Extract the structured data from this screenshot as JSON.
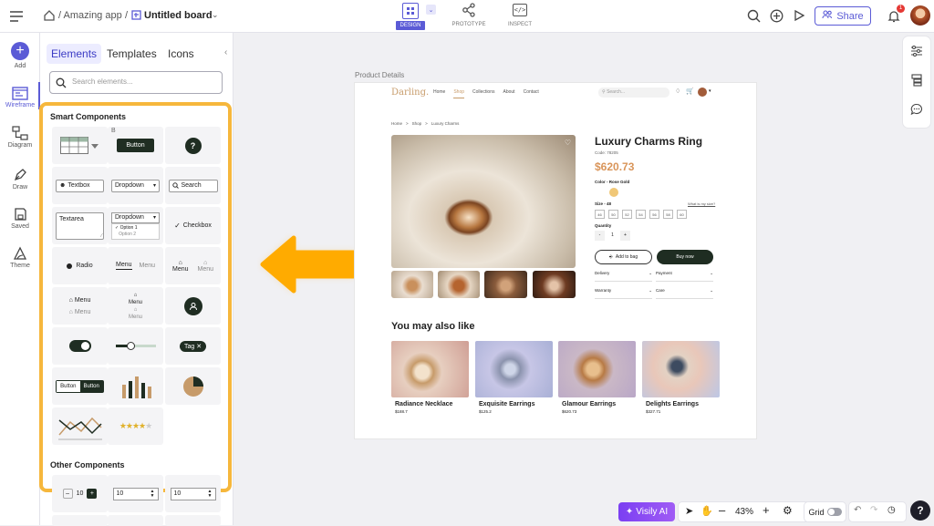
{
  "topbar": {
    "app_crumb": "/ Amazing app",
    "board_sep": "/",
    "board_name": "Untitled board",
    "modes": [
      {
        "label": "DESIGN",
        "active": true
      },
      {
        "label": "PROTOTYPE",
        "active": false
      },
      {
        "label": "INSPECT",
        "active": false
      }
    ],
    "share_label": "Share",
    "notification_count": "1"
  },
  "rail": {
    "items": [
      {
        "label": "Add",
        "icon": "plus-icon"
      },
      {
        "label": "Wireframe",
        "icon": "wireframe-icon"
      },
      {
        "label": "Diagram",
        "icon": "diagram-icon"
      },
      {
        "label": "Draw",
        "icon": "pen-icon"
      },
      {
        "label": "Saved",
        "icon": "save-icon"
      },
      {
        "label": "Theme",
        "icon": "theme-icon"
      }
    ]
  },
  "panel": {
    "tabs": [
      "Elements",
      "Templates",
      "Icons"
    ],
    "search_placeholder": "Search elements...",
    "smart_title": "Smart Components",
    "other_title": "Other Components",
    "components": {
      "button": "Button",
      "button_badge": "B",
      "help": "?",
      "textbox": "Textbox",
      "dropdown1": "Dropdown",
      "search": "Search",
      "textarea": "Textarea",
      "dropdown2": "Dropdown",
      "option1": "Option 1",
      "option2": "Option 2",
      "checkbox": "Checkbox",
      "radio": "Radio",
      "menu_a": "Menu",
      "menu_b": "Menu",
      "menu_c": "Menu",
      "menu_d": "Menu",
      "menu_e": "Menu",
      "menu_f": "Menu",
      "menu_g": "Menu",
      "menu_h": "Menu",
      "tag": "Tag",
      "seg_a": "Button",
      "seg_b": "Button",
      "stepper_value": "10",
      "num_a": "10",
      "num_b": "10"
    }
  },
  "canvas": {
    "board_label": "Product Details",
    "site": {
      "brand": "Darling.",
      "nav": [
        "Home",
        "Shop",
        "Collections",
        "About",
        "Contact"
      ],
      "search_placeholder": "Search...",
      "breadcrumb": [
        "Home",
        ">",
        "Shop",
        ">",
        "Luxury Charms"
      ],
      "product_name": "Luxury Charms Ring",
      "code": "Code: 78205",
      "price": "$620.73",
      "color_label": "Color - Rose Gold",
      "size_label": "Size - 48",
      "size_guide": "What is my size?",
      "sizes": [
        "46",
        "50",
        "52",
        "54",
        "56",
        "58",
        "60"
      ],
      "quantity_label": "Quantity",
      "qty_minus": "-",
      "qty_value": "1",
      "qty_plus": "+",
      "add_to_bag": "Add to bag",
      "buy_now": "Buy now",
      "accordions": [
        "Delivery",
        "Payment",
        "Warranty",
        "Care"
      ],
      "also_like_title": "You may also like",
      "related": [
        {
          "name": "Radiance Necklace",
          "price": "$188.7"
        },
        {
          "name": "Exquisite Earrings",
          "price": "$125.2"
        },
        {
          "name": "Glamour Earrings",
          "price": "$620.73"
        },
        {
          "name": "Delights Earrings",
          "price": "$327.71"
        }
      ]
    }
  },
  "bottombar": {
    "ai_label": "Visily AI",
    "zoom": "43%",
    "grid_label": "Grid",
    "help": "?"
  },
  "colors": {
    "accent": "#5b5bd6",
    "highlight": "#f6b73c",
    "arrow": "#ffab00",
    "price": "#d9955a",
    "dark_button": "#1f2d22",
    "notification": "#e53935"
  }
}
